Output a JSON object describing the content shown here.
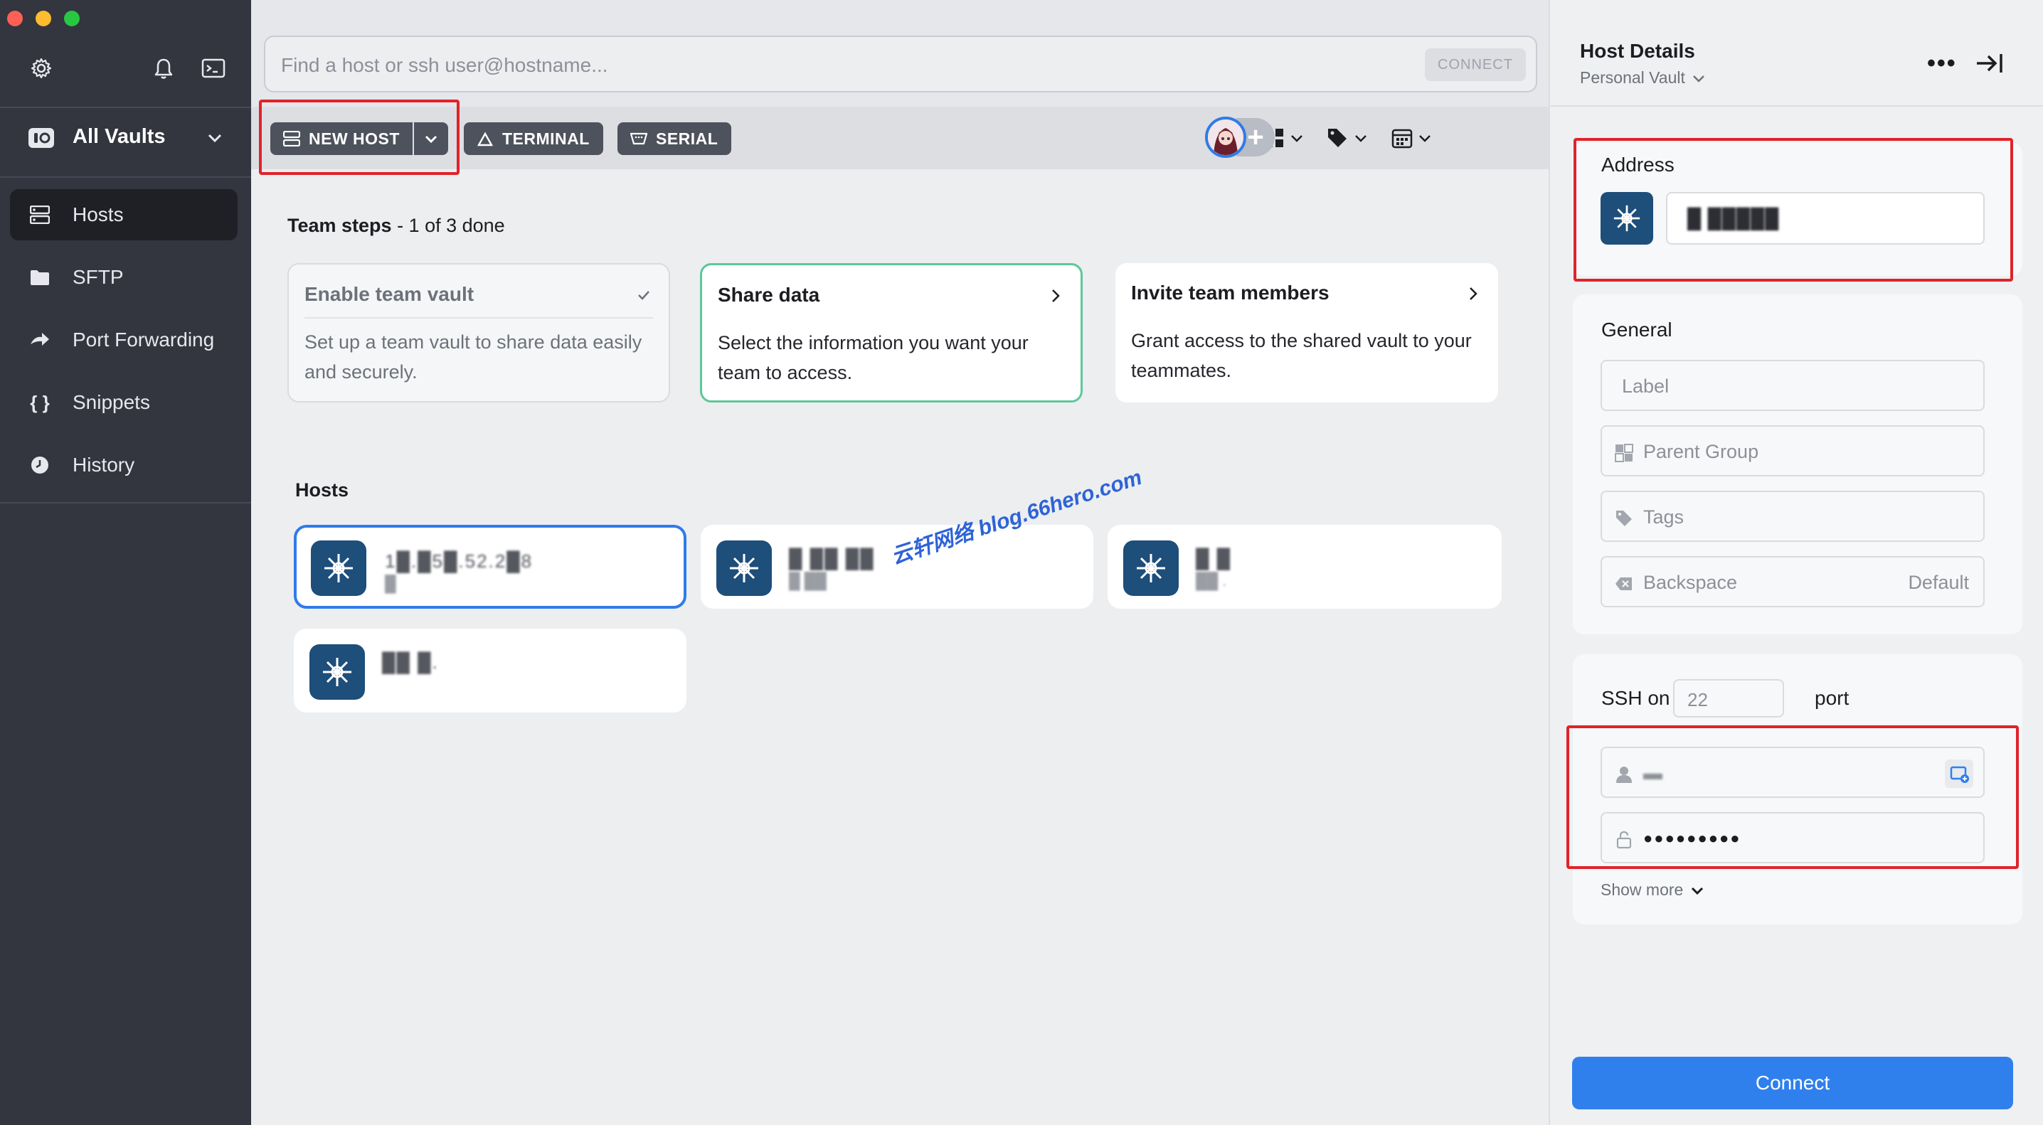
{
  "sidebar": {
    "vault_label": "All Vaults",
    "items": [
      {
        "label": "Hosts",
        "icon": "hosts-icon",
        "active": true
      },
      {
        "label": "SFTP",
        "icon": "folder-icon",
        "active": false
      },
      {
        "label": "Port Forwarding",
        "icon": "port-forwarding-icon",
        "active": false
      },
      {
        "label": "Snippets",
        "icon": "snippets-icon",
        "active": false
      },
      {
        "label": "History",
        "icon": "history-icon",
        "active": false
      }
    ]
  },
  "search": {
    "placeholder": "Find a host or ssh user@hostname...",
    "connect_label": "CONNECT"
  },
  "toolbar": {
    "new_host_label": "NEW HOST",
    "terminal_label": "TERMINAL",
    "serial_label": "SERIAL"
  },
  "team_steps": {
    "title": "Team steps",
    "progress": " - 1 of 3 done",
    "cards": [
      {
        "title": "Enable team vault",
        "desc": "Set up a team vault to share data easily and securely.",
        "done": true
      },
      {
        "title": "Share data",
        "desc": "Select the information you want your team to access.",
        "done": false
      },
      {
        "title": "Invite team members",
        "desc": "Grant access to the shared vault to your teammates.",
        "done": false
      }
    ]
  },
  "hosts": {
    "title": "Hosts",
    "items": [
      {
        "name": "1█.█5█.52.2█8",
        "sub": "█",
        "selected": true
      },
      {
        "name": "█ ██ ██",
        "sub": "█ ██",
        "selected": false
      },
      {
        "name": "█ █",
        "sub": "██ .",
        "selected": false
      },
      {
        "name": "██ █.",
        "sub": "",
        "selected": false
      }
    ]
  },
  "watermark": "云轩网络  blog.66hero.com",
  "details": {
    "title": "Host Details",
    "subtitle": "Personal Vault",
    "more_label": "•••",
    "address_label": "Address",
    "address_value": "█ █████",
    "general_label": "General",
    "label_placeholder": "Label",
    "parent_group_placeholder": "Parent Group",
    "tags_placeholder": "Tags",
    "backspace_label": "Backspace",
    "backspace_value": "Default",
    "ssh_on_label": "SSH on",
    "port_value": "22",
    "port_label": "port",
    "username_value": "▬",
    "password_value": "●●●●●●●●●",
    "show_more_label": "Show more",
    "connect_label": "Connect"
  },
  "colors": {
    "sidebar_bg": "#33363f",
    "accent_blue": "#2f80ed",
    "host_icon_bg": "#1e4e7a",
    "highlight_red": "#e0232a",
    "team_active_border": "#5cc89a"
  }
}
